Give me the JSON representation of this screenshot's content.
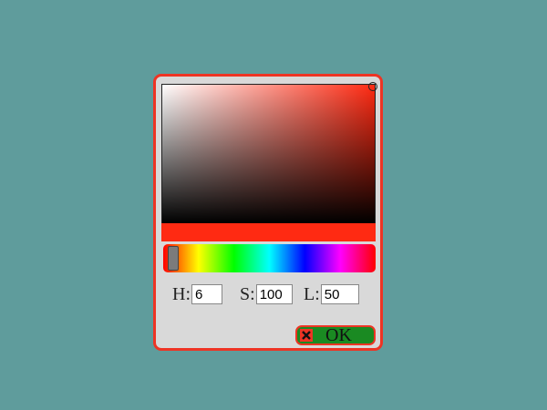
{
  "colors": {
    "background": "#5f9c9c",
    "accent": "#ee3424",
    "selected_color": "#ff2a12",
    "ok_button": "#1a8a22"
  },
  "color_picker": {
    "hue": {
      "label": "H:",
      "value": "6"
    },
    "saturation": {
      "label": "S:",
      "value": "100"
    },
    "lightness": {
      "label": "L:",
      "value": "50"
    },
    "hue_slider_fraction": 0.017,
    "ok_label": "OK",
    "ok_icon": "close-x-icon"
  }
}
